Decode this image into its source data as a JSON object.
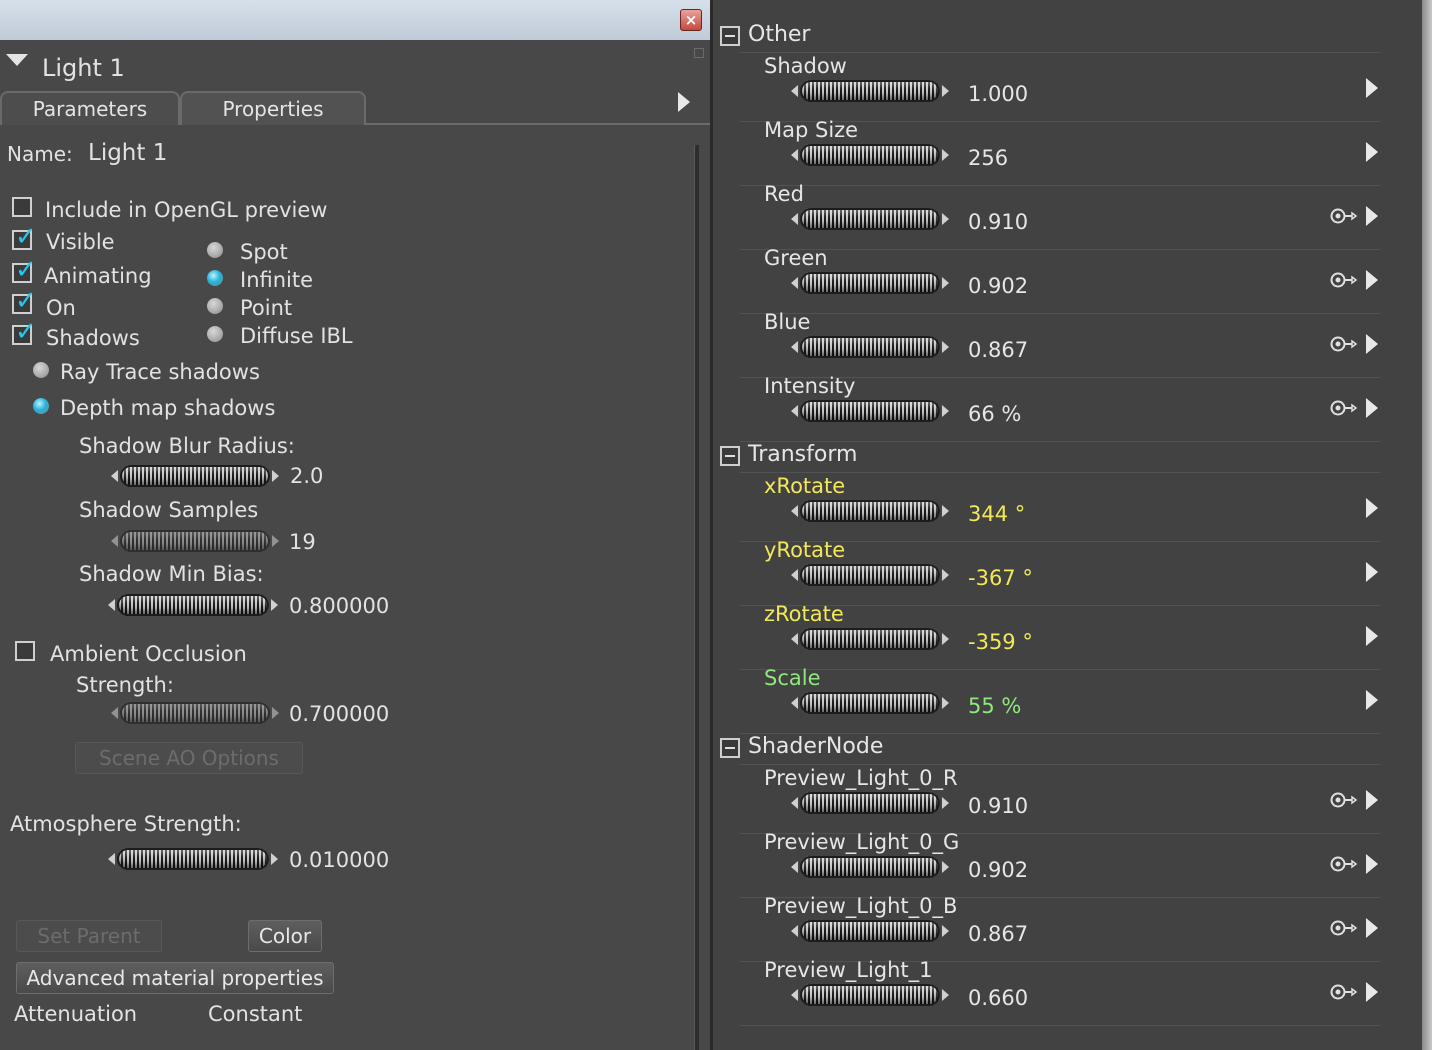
{
  "window": {
    "close_symbol": "×"
  },
  "left_panel": {
    "title": "Light 1",
    "tabs": [
      "Parameters",
      "Properties"
    ],
    "name_label": "Name:",
    "name_value": "Light 1",
    "checkboxes": {
      "opengl": {
        "label": "Include in OpenGL preview",
        "checked": false
      },
      "visible": {
        "label": "Visible",
        "checked": true
      },
      "animating": {
        "label": "Animating",
        "checked": true
      },
      "on": {
        "label": "On",
        "checked": true
      },
      "shadows": {
        "label": "Shadows",
        "checked": true
      }
    },
    "light_types": [
      "Spot",
      "Infinite",
      "Point",
      "Diffuse IBL"
    ],
    "selected_light_type": "Infinite",
    "shadow_modes": [
      "Ray Trace shadows",
      "Depth map shadows"
    ],
    "selected_shadow_mode": "Depth map shadows",
    "shadow_blur_radius": {
      "label": "Shadow Blur Radius:",
      "value": "2.0"
    },
    "shadow_samples": {
      "label": "Shadow Samples",
      "value": "19"
    },
    "shadow_min_bias": {
      "label": "Shadow Min Bias:",
      "value": "0.800000"
    },
    "ambient_occlusion": {
      "label": "Ambient Occlusion",
      "checked": false
    },
    "strength": {
      "label": "Strength:",
      "value": "0.700000"
    },
    "scene_ao_button": "Scene AO Options",
    "atmosphere": {
      "label": "Atmosphere Strength:",
      "value": "0.010000"
    },
    "set_parent_button": "Set Parent",
    "color_button": "Color",
    "advanced_button": "Advanced material properties",
    "attenuation_label": "Attenuation",
    "attenuation_value": "Constant"
  },
  "right_panel": {
    "sections": [
      {
        "title": "Other",
        "rows": [
          {
            "label": "Shadow",
            "value": "1.000",
            "key": false,
            "color": "#e6e6e6"
          },
          {
            "label": "Map Size",
            "value": "256",
            "key": false,
            "color": "#e6e6e6"
          },
          {
            "label": "Red",
            "value": "0.910",
            "key": true,
            "color": "#e6e6e6"
          },
          {
            "label": "Green",
            "value": "0.902",
            "key": true,
            "color": "#e6e6e6"
          },
          {
            "label": "Blue",
            "value": "0.867",
            "key": true,
            "color": "#e6e6e6"
          },
          {
            "label": "Intensity",
            "value": "66 %",
            "key": true,
            "color": "#e6e6e6"
          }
        ]
      },
      {
        "title": "Transform",
        "rows": [
          {
            "label": "xRotate",
            "value": "344 °",
            "key": false,
            "color": "#f2e85a"
          },
          {
            "label": "yRotate",
            "value": "-367 °",
            "key": false,
            "color": "#f2e85a"
          },
          {
            "label": "zRotate",
            "value": "-359 °",
            "key": false,
            "color": "#f2e85a"
          },
          {
            "label": "Scale",
            "value": "55 %",
            "key": false,
            "color": "#8ee87a"
          }
        ]
      },
      {
        "title": "ShaderNode",
        "rows": [
          {
            "label": "Preview_Light_0_R",
            "value": "0.910",
            "key": true,
            "color": "#e6e6e6"
          },
          {
            "label": "Preview_Light_0_G",
            "value": "0.902",
            "key": true,
            "color": "#e6e6e6"
          },
          {
            "label": "Preview_Light_0_B",
            "value": "0.867",
            "key": true,
            "color": "#e6e6e6"
          },
          {
            "label": "Preview_Light_1",
            "value": "0.660",
            "key": true,
            "color": "#e6e6e6"
          }
        ]
      }
    ]
  }
}
